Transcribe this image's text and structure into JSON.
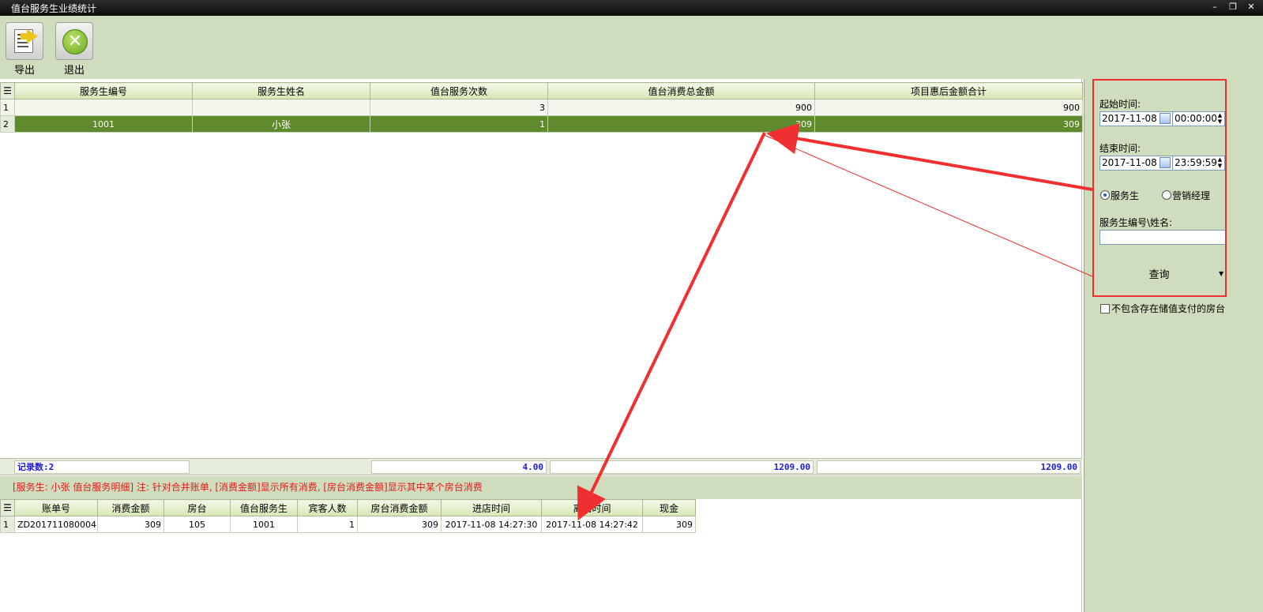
{
  "window": {
    "title": "值台服务生业绩统计",
    "controls": [
      "–",
      "❐",
      "✕"
    ]
  },
  "toolbar": {
    "export_label": "导出",
    "exit_label": "退出"
  },
  "main_grid": {
    "columns": [
      "服务生编号",
      "服务生姓名",
      "值台服务次数",
      "值台消费总金额",
      "项目惠后金额合计"
    ],
    "rows": [
      {
        "num": "1",
        "id": "",
        "name": "",
        "count": "3",
        "total": "900",
        "discount_total": "900"
      },
      {
        "num": "2",
        "id": "1001",
        "name": "小张",
        "count": "1",
        "total": "309",
        "discount_total": "309"
      }
    ]
  },
  "summary": {
    "record_count": "记录数:2",
    "count_sum": "4.00",
    "total_sum": "1209.00",
    "discount_sum": "1209.00"
  },
  "info_text": "[服务生: 小张 值台服务明细]   注: 针对合并账单, [消费金额]显示所有消费, [房台消费金额]显示其中某个房台消费",
  "detail_grid": {
    "columns": [
      "账单号",
      "消费金额",
      "房台",
      "值台服务生",
      "宾客人数",
      "房台消费金额",
      "进店时间",
      "离店时间",
      "现金"
    ],
    "rows": [
      {
        "num": "1",
        "bill_no": "ZD201711080004",
        "amount": "309",
        "room": "105",
        "waiter": "1001",
        "guests": "1",
        "room_amount": "309",
        "checkin": "2017-11-08 14:27:30",
        "checkout": "2017-11-08 14:27:42",
        "cash": "309"
      }
    ]
  },
  "filter": {
    "start_label": "起始时间:",
    "start_date": "2017-11-08",
    "start_time": "00:00:00",
    "end_label": "结束时间:",
    "end_date": "2017-11-08",
    "end_time": "23:59:59",
    "radio_waiter": "服务生",
    "radio_manager": "营销经理",
    "selected": "服务生",
    "search_label": "服务生编号\\姓名:",
    "search_value": "",
    "query_label": "查询",
    "exclude_label": "不包含存在储值支付的房台",
    "exclude_checked": false
  },
  "colors": {
    "selected_row": "#5f8a2d",
    "annotation": "#f03030",
    "panel_bg": "#cfdcbd"
  }
}
